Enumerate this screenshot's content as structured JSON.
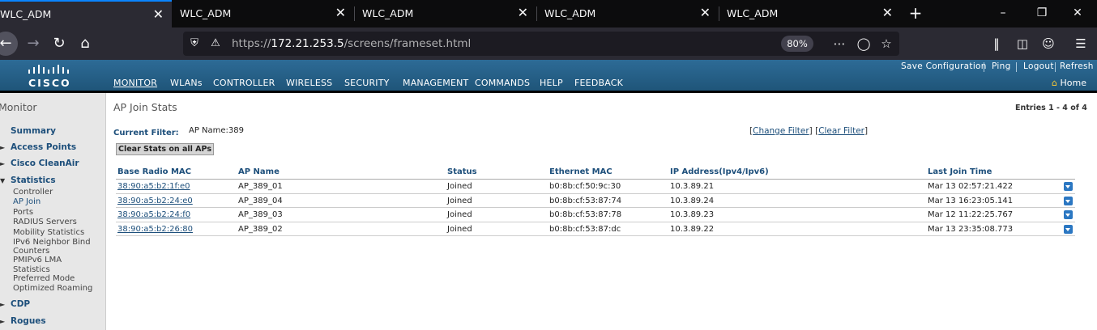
{
  "browser": {
    "tabs": [
      {
        "title": "WLC_ADM",
        "close": "✕"
      },
      {
        "title": "WLC_ADM",
        "close": "✕"
      },
      {
        "title": "WLC_ADM",
        "close": "✕"
      },
      {
        "title": "WLC_ADM",
        "close": "✕"
      },
      {
        "title": "WLC_ADM",
        "close": "✕"
      }
    ],
    "url_prefix": "https://",
    "url_host": "172.21.253.5",
    "url_path": "/screens/frameset.html",
    "zoom": "80%"
  },
  "cisco": {
    "logo_text": "CISCO",
    "nav": [
      {
        "label": "MONITOR"
      },
      {
        "label": "WLANs"
      },
      {
        "label": "CONTROLLER"
      },
      {
        "label": "WIRELESS"
      },
      {
        "label": "SECURITY"
      },
      {
        "label": "MANAGEMENT"
      },
      {
        "label": "COMMANDS"
      },
      {
        "label": "HELP"
      },
      {
        "label": "FEEDBACK"
      }
    ],
    "top_links": {
      "save": "Save Configuration",
      "ping": "Ping",
      "logout": "Logout",
      "refresh": "Refresh"
    },
    "home": "Home"
  },
  "sidebar": {
    "title": "Monitor",
    "summary": "Summary",
    "access_points": "Access Points",
    "cleanair": "Cisco CleanAir",
    "statistics": "Statistics",
    "stat_items": {
      "controller": "Controller",
      "ap_join": "AP Join",
      "ports": "Ports",
      "radius": "RADIUS Servers",
      "mobility": "Mobility Statistics",
      "ipv6_1": "IPv6 Neighbor Bind",
      "ipv6_2": "Counters",
      "pmipv6_1": "PMIPv6 LMA",
      "pmipv6_2": "Statistics",
      "preferred": "Preferred Mode",
      "roaming": "Optimized Roaming"
    },
    "cdp": "CDP",
    "rogues": "Rogues"
  },
  "main": {
    "title": "AP Join Stats",
    "entries": "Entries 1 - 4 of 4",
    "filter_label": "Current Filter:",
    "filter_value": "AP Name:389",
    "change_filter": "Change Filter",
    "clear_filter": "Clear Filter",
    "clear_stats_button": "Clear Stats on all APs",
    "columns": {
      "base_mac": "Base Radio MAC",
      "ap_name": "AP Name",
      "status": "Status",
      "eth_mac": "Ethernet MAC",
      "ip": "IP Address(Ipv4/Ipv6)",
      "last_join": "Last Join Time"
    },
    "rows": [
      {
        "base_mac": "38:90:a5:b2:1f:e0",
        "ap_name": "AP_389_01",
        "status": "Joined",
        "eth_mac": "b0:8b:cf:50:9c:30",
        "ip": "10.3.89.21",
        "last_join": "Mar 13 02:57:21.422"
      },
      {
        "base_mac": "38:90:a5:b2:24:e0",
        "ap_name": "AP_389_04",
        "status": "Joined",
        "eth_mac": "b0:8b:cf:53:87:74",
        "ip": "10.3.89.24",
        "last_join": "Mar 13 16:23:05.141"
      },
      {
        "base_mac": "38:90:a5:b2:24:f0",
        "ap_name": "AP_389_03",
        "status": "Joined",
        "eth_mac": "b0:8b:cf:53:87:78",
        "ip": "10.3.89.23",
        "last_join": "Mar 12 11:22:25.767"
      },
      {
        "base_mac": "38:90:a5:b2:26:80",
        "ap_name": "AP_389_02",
        "status": "Joined",
        "eth_mac": "b0:8b:cf:53:87:dc",
        "ip": "10.3.89.22",
        "last_join": "Mar 13 23:35:08.773"
      }
    ]
  }
}
